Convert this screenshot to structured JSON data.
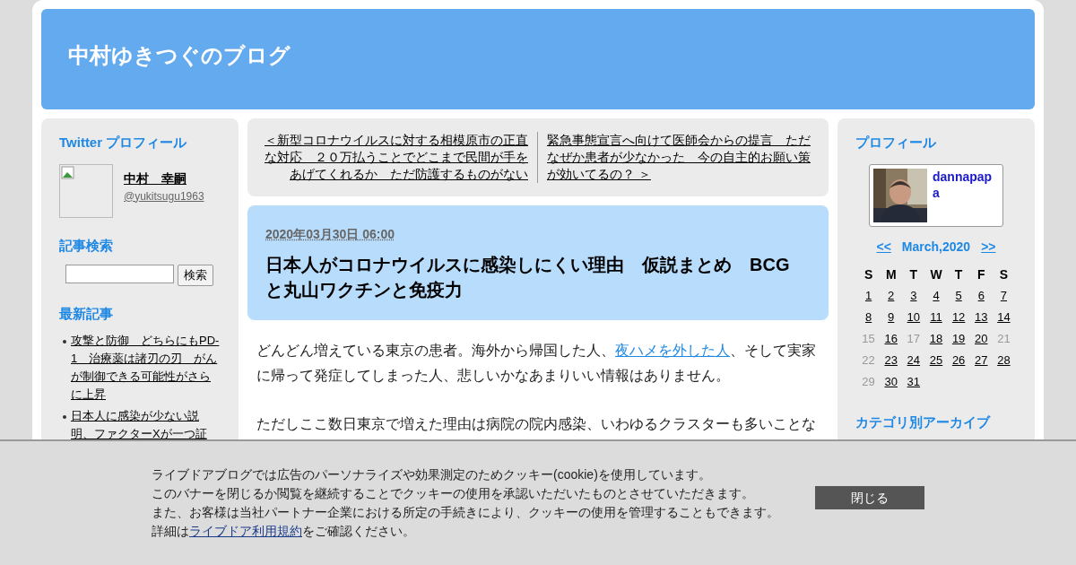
{
  "header": {
    "title": "中村ゆきつぐのブログ"
  },
  "left_sidebar": {
    "twitter": {
      "heading": "Twitter プロフィール",
      "name": "中村　幸嗣",
      "handle": "@yukitsugu1963"
    },
    "search": {
      "heading": "記事検索",
      "button": "検索"
    },
    "recent": {
      "heading": "最新記事",
      "items": [
        "攻撃と防御　どちらにもPD-1　治療薬は諸刃の刃　がんが制御できる可能性がさらに上昇",
        "日本人に感染が少ない説明、ファクターXが一つ証"
      ]
    }
  },
  "nav": {
    "prev": "＜新型コロナウイルスに対する相模原市の正直な対応　２０万払うことでどこまで民間が手をあげてくれるか　ただ防護するものがない",
    "next": "緊急事態宣言へ向けて医師会からの提言　ただなぜか患者が少なかった　今の自主的お願い策が効いてるの？ ＞"
  },
  "article": {
    "date": "2020年03月30日 06:00",
    "title": "日本人がコロナウイルスに感染しにくい理由　仮説まとめ　BCGと丸山ワクチンと免疫力",
    "paragraphs": [
      [
        {
          "text": "どんどん増えている東京の患者。海外から帰国した人、",
          "link": false
        },
        {
          "text": "夜ハメを外した人",
          "link": true
        },
        {
          "text": "、そして実家に帰って発症してしまった人、悲しいかなあまりいい情報はありません。",
          "link": false
        }
      ],
      [
        {
          "text": "ただしここ数日東京で増えた理由は病院の院内感染、いわゆるクラスターも多いことな",
          "link": false
        }
      ]
    ]
  },
  "right_sidebar": {
    "profile": {
      "heading": "プロフィール",
      "name": "dannapapa"
    },
    "calendar": {
      "prev": "<<",
      "month": "March,2020",
      "next": ">>",
      "weekdays": [
        "S",
        "M",
        "T",
        "W",
        "T",
        "F",
        "S"
      ],
      "days": [
        {
          "label": "1",
          "linked": true
        },
        {
          "label": "2",
          "linked": true
        },
        {
          "label": "3",
          "linked": true
        },
        {
          "label": "4",
          "linked": true
        },
        {
          "label": "5",
          "linked": true
        },
        {
          "label": "6",
          "linked": true
        },
        {
          "label": "7",
          "linked": true
        },
        {
          "label": "8",
          "linked": true
        },
        {
          "label": "9",
          "linked": true
        },
        {
          "label": "10",
          "linked": true
        },
        {
          "label": "11",
          "linked": true
        },
        {
          "label": "12",
          "linked": true
        },
        {
          "label": "13",
          "linked": true
        },
        {
          "label": "14",
          "linked": true
        },
        {
          "label": "15",
          "linked": false
        },
        {
          "label": "16",
          "linked": true
        },
        {
          "label": "17",
          "linked": false
        },
        {
          "label": "18",
          "linked": true
        },
        {
          "label": "19",
          "linked": true
        },
        {
          "label": "20",
          "linked": true
        },
        {
          "label": "21",
          "linked": false
        },
        {
          "label": "22",
          "linked": false
        },
        {
          "label": "23",
          "linked": true
        },
        {
          "label": "24",
          "linked": true
        },
        {
          "label": "25",
          "linked": true
        },
        {
          "label": "26",
          "linked": true
        },
        {
          "label": "27",
          "linked": true
        },
        {
          "label": "28",
          "linked": true
        },
        {
          "label": "29",
          "linked": false
        },
        {
          "label": "30",
          "linked": true
        },
        {
          "label": "31",
          "linked": true
        }
      ]
    },
    "archive_heading": "カテゴリ別アーカイブ"
  },
  "cookie_banner": {
    "lines": [
      [
        {
          "text": "ライブドアブログでは広告のパーソナライズや効果測定のためクッキー(cookie)を使用しています。",
          "link": false
        }
      ],
      [
        {
          "text": "このバナーを閉じるか閲覧を継続することでクッキーの使用を承認いただいたものとさせていただきます。",
          "link": false
        }
      ],
      [
        {
          "text": "また、お客様は当社パートナー企業における所定の手続きにより、クッキーの使用を管理することもできます。",
          "link": false
        }
      ],
      [
        {
          "text": "詳細は",
          "link": false
        },
        {
          "text": "ライブドア利用規約",
          "link": true
        },
        {
          "text": "をご確認ください。",
          "link": false
        }
      ]
    ],
    "button": "閉じる"
  }
}
